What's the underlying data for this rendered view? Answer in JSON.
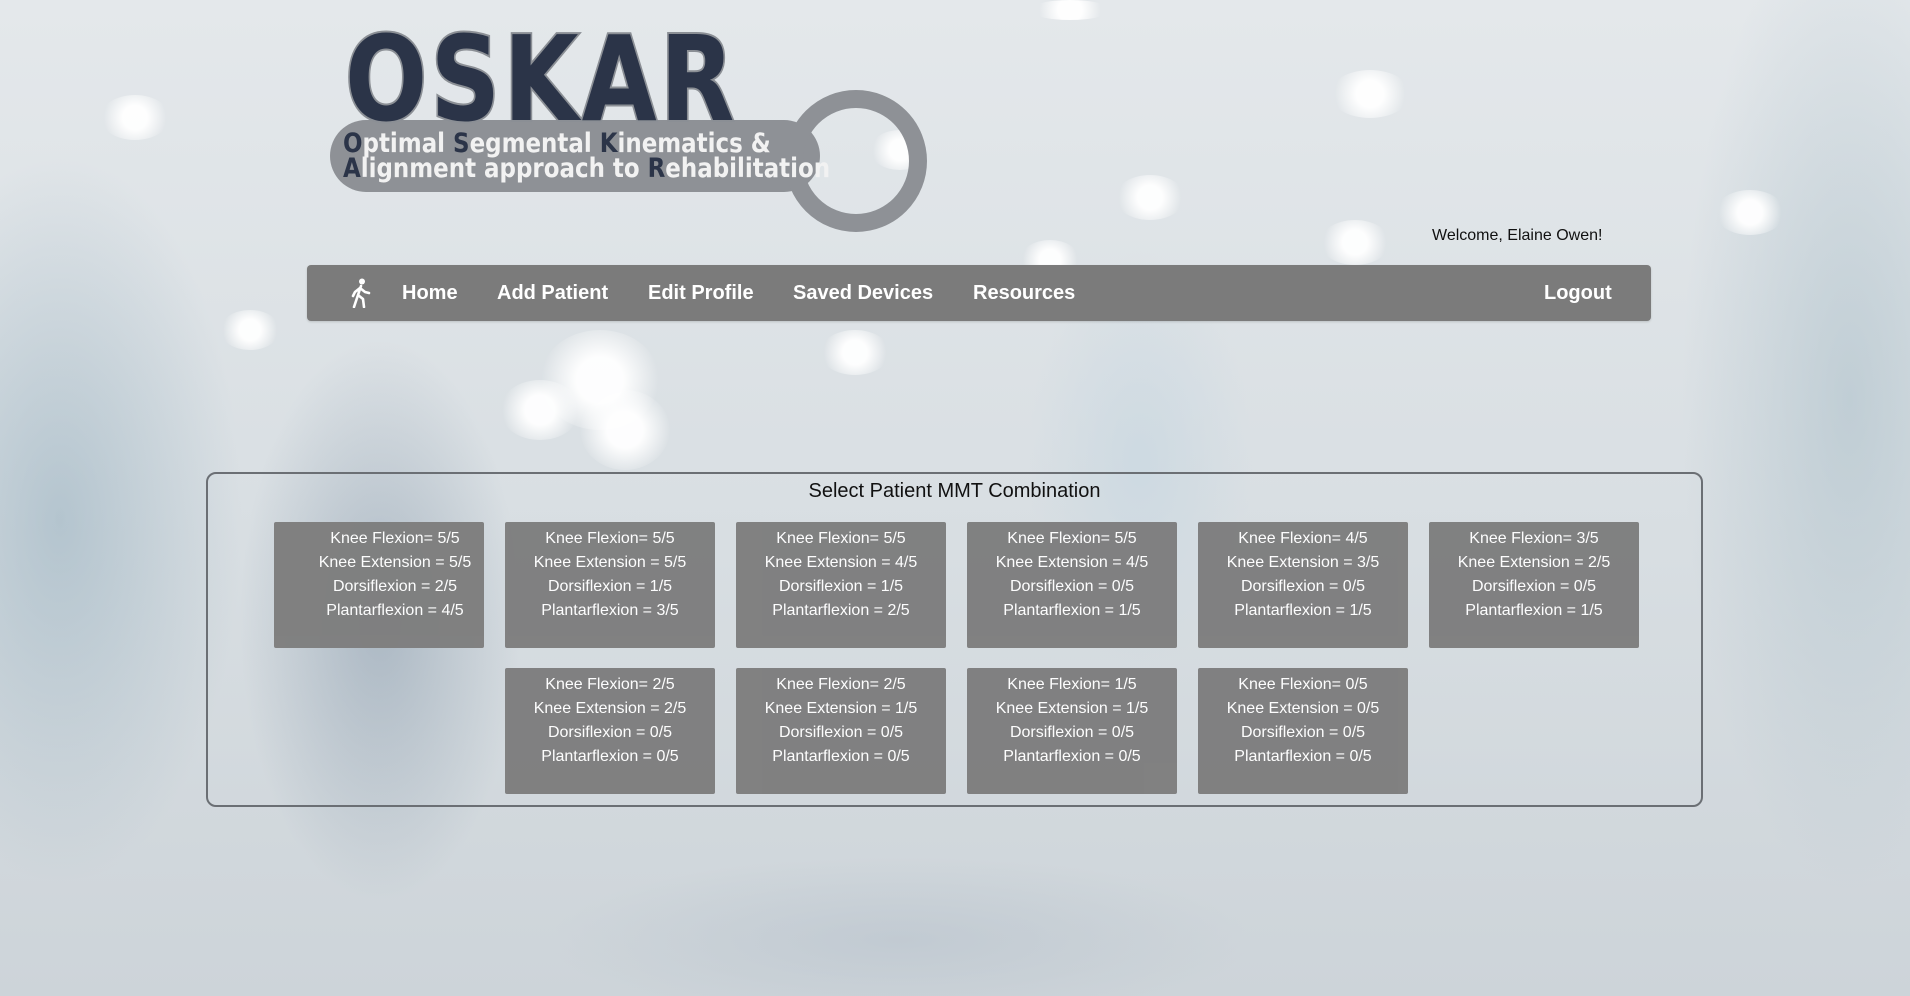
{
  "logo": {
    "word": "OSKAR",
    "line1": [
      {
        "cap": "O",
        "rest": "ptimal "
      },
      {
        "cap": "S",
        "rest": "egmental "
      },
      {
        "cap": "K",
        "rest": "inematics &"
      }
    ],
    "line2": [
      {
        "cap": "A",
        "rest": "lignment approach to "
      },
      {
        "cap": "R",
        "rest": "ehabilitation"
      }
    ]
  },
  "welcome": "Welcome, Elaine Owen!",
  "nav": {
    "icon": "walking-person-icon",
    "items": [
      "Home",
      "Add Patient",
      "Edit Profile",
      "Saved Devices",
      "Resources"
    ],
    "logout": "Logout"
  },
  "panel": {
    "title": "Select Patient MMT Combination",
    "cards": [
      {
        "knee_flexion": "Knee Flexion= 5/5",
        "knee_extension": "Knee Extension = 5/5",
        "dorsiflexion": "Dorsiflexion = 2/5",
        "plantarflexion": "Plantarflexion = 4/5"
      },
      {
        "knee_flexion": "Knee Flexion= 5/5",
        "knee_extension": "Knee Extension = 5/5",
        "dorsiflexion": "Dorsiflexion = 1/5",
        "plantarflexion": "Plantarflexion = 3/5"
      },
      {
        "knee_flexion": "Knee Flexion= 5/5",
        "knee_extension": "Knee Extension = 4/5",
        "dorsiflexion": "Dorsiflexion = 1/5",
        "plantarflexion": "Plantarflexion = 2/5"
      },
      {
        "knee_flexion": "Knee Flexion= 5/5",
        "knee_extension": "Knee Extension = 4/5",
        "dorsiflexion": "Dorsiflexion = 0/5",
        "plantarflexion": "Plantarflexion = 1/5"
      },
      {
        "knee_flexion": "Knee Flexion= 4/5",
        "knee_extension": "Knee Extension = 3/5",
        "dorsiflexion": "Dorsiflexion = 0/5",
        "plantarflexion": "Plantarflexion = 1/5"
      },
      {
        "knee_flexion": "Knee Flexion= 3/5",
        "knee_extension": "Knee Extension = 2/5",
        "dorsiflexion": "Dorsiflexion = 0/5",
        "plantarflexion": "Plantarflexion = 1/5"
      },
      {
        "knee_flexion": "Knee Flexion= 2/5",
        "knee_extension": "Knee Extension = 2/5",
        "dorsiflexion": "Dorsiflexion = 0/5",
        "plantarflexion": "Plantarflexion = 0/5"
      },
      {
        "knee_flexion": "Knee Flexion= 2/5",
        "knee_extension": "Knee Extension = 1/5",
        "dorsiflexion": "Dorsiflexion = 0/5",
        "plantarflexion": "Plantarflexion = 0/5"
      },
      {
        "knee_flexion": "Knee Flexion= 1/5",
        "knee_extension": "Knee Extension = 1/5",
        "dorsiflexion": "Dorsiflexion = 0/5",
        "plantarflexion": "Plantarflexion = 0/5"
      },
      {
        "knee_flexion": "Knee Flexion= 0/5",
        "knee_extension": "Knee Extension = 0/5",
        "dorsiflexion": "Dorsiflexion = 0/5",
        "plantarflexion": "Plantarflexion = 0/5"
      }
    ]
  },
  "colors": {
    "nav_bg": "#7b7b7b",
    "card_bg": "#7e7e7e",
    "logo_navy": "#2b3448",
    "logo_gray": "#8e9196"
  }
}
